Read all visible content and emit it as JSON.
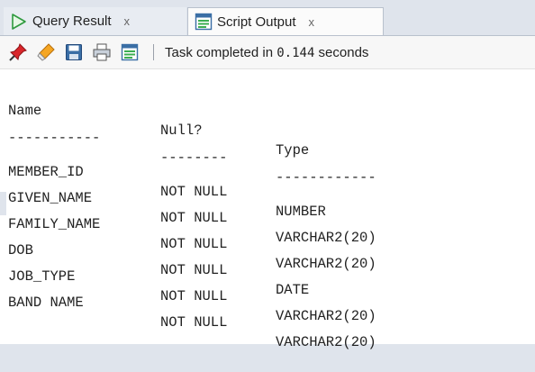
{
  "tabs": [
    {
      "label": "Query Result",
      "close": "x",
      "icon": "play-triangle-icon"
    },
    {
      "label": "Script Output",
      "close": "x",
      "icon": "script-document-icon"
    }
  ],
  "toolbar": {
    "icons": [
      "pin-icon",
      "eraser-icon",
      "save-icon",
      "print-icon",
      "document-icon"
    ],
    "status_prefix": "Task completed in ",
    "status_time": "0.144",
    "status_suffix": " seconds"
  },
  "output": {
    "headers": [
      "Name",
      "Null?",
      "Type"
    ],
    "dividers": [
      "-----------",
      "--------",
      "------------"
    ],
    "rows": [
      [
        "MEMBER_ID",
        "NOT NULL",
        "NUMBER"
      ],
      [
        "GIVEN_NAME",
        "NOT NULL",
        "VARCHAR2(20)"
      ],
      [
        "FAMILY_NAME",
        "NOT NULL",
        "VARCHAR2(20)"
      ],
      [
        "DOB",
        "NOT NULL",
        "DATE"
      ],
      [
        "JOB_TYPE",
        "NOT NULL",
        "VARCHAR2(20)"
      ],
      [
        "BAND NAME",
        "NOT NULL",
        "VARCHAR2(20)"
      ]
    ]
  }
}
